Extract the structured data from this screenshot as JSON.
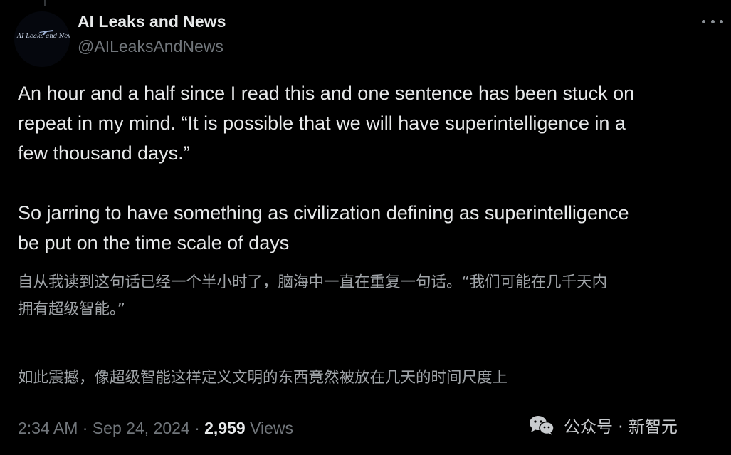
{
  "author": {
    "display_name": "AI Leaks and News",
    "handle": "@AILeaksAndNews",
    "avatar_text": "AI Leaks and News"
  },
  "tweet": {
    "lines_p1": [
      "An hour and a half since I read this and one sentence has been stuck on",
      "repeat in my mind. “It is possible that we will have superintelligence in a",
      "few thousand days.”"
    ],
    "lines_p2": [
      "So jarring to have something as civilization defining as superintelligence",
      "be put on the time scale of days"
    ]
  },
  "translation": {
    "lines_p1": [
      "自从我读到这句话已经一个半小时了，脑海中一直在重复一句话。“我们可能在几千天内",
      "拥有超级智能。”"
    ],
    "lines_p2": [
      "如此震撼，像超级智能这样定义文明的东西竟然被放在几天的时间尺度上"
    ]
  },
  "meta": {
    "time": "2:34 AM",
    "separator": "·",
    "date": "Sep 24, 2024",
    "views_count": "2,959",
    "views_label": "Views"
  },
  "watermark": {
    "text": "公众号 · 新智元",
    "icon": "wechat-icon"
  },
  "colors": {
    "background": "#000000",
    "primary_text": "#e7e9ea",
    "secondary_text": "#71767b",
    "translation_text": "#a0a4a8"
  }
}
